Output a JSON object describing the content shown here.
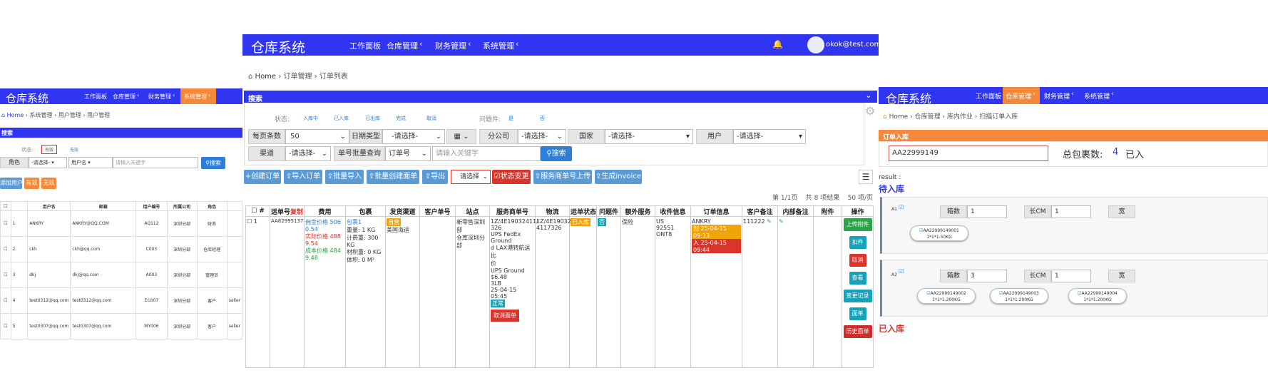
{
  "left": {
    "brand": "仓库系统",
    "nav": [
      "工作面板",
      "仓库管理",
      "财务管理",
      "系统管理"
    ],
    "breadcrumb": [
      "Home",
      "系统管理",
      "用户管理",
      "用户管理"
    ],
    "search_title": "搜索",
    "status_label": "状态:",
    "status_options": [
      "有效",
      "无效"
    ],
    "role_label": "角色",
    "role_select": "-请选择-",
    "username_select": "用户名",
    "keyword_placeholder": "请输入关键字",
    "search_button": "搜索",
    "add_button": "添加用户",
    "valid_button": "有效",
    "invalid_button": "无效",
    "columns": [
      "",
      "用户名",
      "邮箱",
      "用户编号",
      "所属公司",
      "角色",
      ""
    ],
    "rows": [
      {
        "n": "1",
        "user": "ANKRY",
        "email": "ANKRY@QQ.COM",
        "code": "AQ112",
        "company": "深圳分部",
        "role": "财务",
        "extra": ""
      },
      {
        "n": "2",
        "user": "ckh",
        "email": "ckh@qq.com",
        "code": "C003",
        "company": "深圳分部",
        "role": "仓库经理",
        "extra": ""
      },
      {
        "n": "3",
        "user": "dkj",
        "email": "dkj@qq.com",
        "code": "A003",
        "company": "深圳分部",
        "role": "管理员",
        "extra": ""
      },
      {
        "n": "4",
        "user": "test0312@qq.com",
        "email": "test0312@qq.com",
        "code": "EC007",
        "company": "深圳分部",
        "role": "客户",
        "extra": "seller"
      },
      {
        "n": "5",
        "user": "test0307@qq.com",
        "email": "test0307@qq.com",
        "code": "MY006",
        "company": "深圳分部",
        "role": "客户",
        "extra": "seller"
      }
    ]
  },
  "center": {
    "brand": "仓库系统",
    "nav": [
      "工作面板",
      "仓库管理",
      "财务管理",
      "系统管理"
    ],
    "user_email": "okok@test.com",
    "breadcrumb": [
      "Home",
      "订单管理",
      "订单列表"
    ],
    "search_title": "搜索",
    "status_label": "状态:",
    "status_options": [
      "入库中",
      "已入库",
      "已出库",
      "完成",
      "取消"
    ],
    "issue_label": "问题件:",
    "issue_options": [
      "是",
      "否"
    ],
    "row1": {
      "page_size_label": "每页条数",
      "page_size": "50",
      "date_type_label": "日期类型",
      "date_type": "-请选择-",
      "branch_label": "分公司",
      "branch": "-请选择-",
      "country_label": "国家",
      "country": "-请选择-",
      "user_label": "用户",
      "user": "-请选择-"
    },
    "row2": {
      "channel_label": "渠道",
      "channel": "-请选择-",
      "batch_label": "单号批量查询",
      "order_no": "订单号",
      "keyword_placeholder": "请输入关键字",
      "search_button": "搜索"
    },
    "toolbar": [
      "创建订单",
      "导入订单",
      "批量导入",
      "批量创建面单",
      "导出",
      "请选择",
      "状态变更",
      "服务商单号上传",
      "生成invoice"
    ],
    "pagination": "第 1/1页    共 8 项结果    50 项/页",
    "columns": [
      "#",
      "运单号",
      "费用",
      "包裹",
      "发货渠道",
      "客户单号",
      "站点",
      "服务商单号",
      "物流",
      "运单状态",
      "问题件",
      "额外服务",
      "收件信息",
      "订单信息",
      "客户备注",
      "内部备注",
      "附件",
      "操作"
    ],
    "waybill_copy": "复制",
    "row": {
      "n": "1",
      "waybill": "AA82995137",
      "fee": [
        "佣金价格 506",
        "0.54",
        "实际价格 488",
        "9.54",
        "成本价格 484",
        "9.48"
      ],
      "package": [
        "包裹1",
        "重量: 1 KG",
        "计费重: 300 KG",
        "材积重: 0 KG",
        "体积: 0 M³"
      ],
      "channel_tag": "自营",
      "channel": "美国海运",
      "site": [
        "新零售深圳",
        "部",
        "仓库深圳分",
        "部"
      ],
      "service_no": [
        "1Z/4E19032411/",
        "326",
        "UPS FedEx Ground",
        "d LAX港转航运比",
        "价",
        "UPS Ground",
        "$6.48",
        "3LB",
        "25-04-15 05:45"
      ],
      "service_tag": "正常",
      "cancel_label_btn": "取消面单",
      "logistics": [
        "1Z/4E19032",
        "4117326"
      ],
      "status_tag": "已入库",
      "issue_tag": "否",
      "extra_service": "保险",
      "recipient": [
        "US",
        "92551",
        "ONT8"
      ],
      "order_info_name": "ANKRY",
      "order_info_tags": [
        "创 25-04-15 09:13",
        "入 25-04-15 09:44"
      ],
      "customer_note": "111222",
      "ops": [
        "上传附件",
        "扣件",
        "取消",
        "查看",
        "变更记录",
        "面单",
        "历史面单"
      ]
    }
  },
  "right": {
    "brand": "仓库系统",
    "nav": [
      "工作面板",
      "仓库管理",
      "财务管理",
      "系统管理"
    ],
    "breadcrumb": [
      "Home",
      "仓库管理",
      "库内作业",
      "扫描订单入库"
    ],
    "section_title": "订单入库",
    "scan_value": "AA22999149",
    "total_label": "总包裹数:",
    "total_value": "4",
    "inbound_label": "已入",
    "result_label": "result :",
    "pending_label": "待入库",
    "box1": {
      "tag": "A1",
      "count_label": "箱数",
      "count": "1",
      "len_label": "长CM",
      "len": "1",
      "items": [
        {
          "code": "AA22999149001",
          "spec": "1*1*1.50KG"
        }
      ]
    },
    "box2": {
      "tag": "A2",
      "count_label": "箱数",
      "count": "3",
      "len_label": "长CM",
      "len": "1",
      "items": [
        {
          "code": "AA22999149002",
          "spec": "1*1*1.200KG"
        },
        {
          "code": "AA22999149003",
          "spec": "1*1*1.200KG"
        },
        {
          "code": "AA22999149004",
          "spec": "1*1*1.200KG"
        }
      ]
    },
    "done_label": "已入库"
  },
  "colors": {
    "primary": "#2f35f0",
    "orange": "#f6883a",
    "red": "#d9352d",
    "green": "#2ca24a"
  }
}
